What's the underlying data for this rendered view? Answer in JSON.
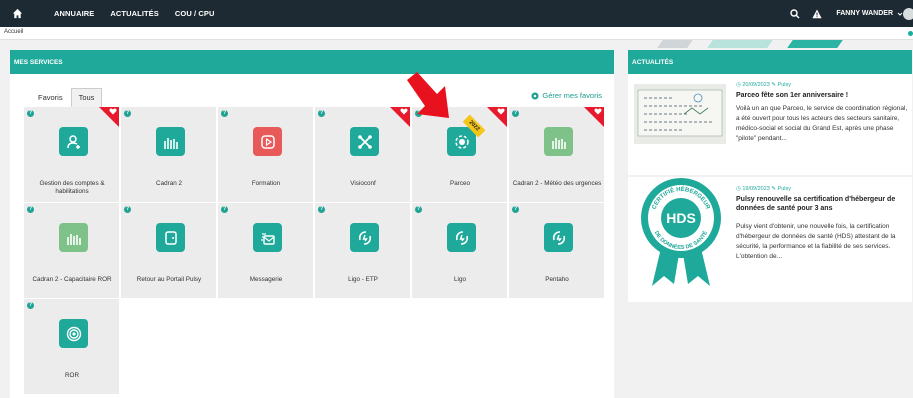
{
  "nav": {
    "items": [
      "ANNUAIRE",
      "ACTUALITÉS",
      "COU / CPU"
    ],
    "user": "FANNY WANDER"
  },
  "breadcrumb": "Accueil",
  "services": {
    "title": "MES SERVICES",
    "tabs": [
      "Favoris",
      "Tous"
    ],
    "manage_label": "Gérer mes favoris",
    "tiles": [
      {
        "label": "Gestion des comptes & habilitations",
        "icon": "user-plus-icon",
        "color": "#1fa99a",
        "fav": true
      },
      {
        "label": "Cadran 2",
        "icon": "bars-icon",
        "color": "#1fa99a",
        "fav": false
      },
      {
        "label": "Formation",
        "icon": "play-icon",
        "color": "#e85a5a",
        "fav": false
      },
      {
        "label": "Visioconf",
        "icon": "share-icon",
        "color": "#1fa99a",
        "fav": true
      },
      {
        "label": "Parceo",
        "icon": "parceo-icon",
        "color": "#1fa99a",
        "fav": true,
        "badge": "2022"
      },
      {
        "label": "Cadran 2 - Météo des urgences",
        "icon": "bars-icon",
        "color": "#7ec28a",
        "fav": true
      },
      {
        "label": "Cadran 2 - Capacitaire ROR",
        "icon": "bars-icon",
        "color": "#7ec28a",
        "fav": false
      },
      {
        "label": "Retour au Portail Pulsy",
        "icon": "portal-icon",
        "color": "#1fa99a",
        "fav": false
      },
      {
        "label": "Messagerie",
        "icon": "mail-icon",
        "color": "#1fa99a",
        "fav": false
      },
      {
        "label": "Ligo - ETP",
        "icon": "ligo-icon",
        "color": "#1fa99a",
        "fav": false
      },
      {
        "label": "Ligo",
        "icon": "ligo-icon",
        "color": "#1fa99a",
        "fav": false
      },
      {
        "label": "Pentaho",
        "icon": "ligo-icon",
        "color": "#1fa99a",
        "fav": false
      },
      {
        "label": "ROR",
        "icon": "target-icon",
        "color": "#1fa99a",
        "fav": false
      }
    ]
  },
  "news": {
    "title": "ACTUALITÉS",
    "items": [
      {
        "date": "20/09/2023",
        "tag": "Pulsy",
        "title": "Parceo fête son 1er anniversaire !",
        "body": "Voilà un an que Parceo, le service de coordination régional, a été ouvert pour tous les acteurs des secteurs sanitaire, médico-social et social du Grand Est, après une phase \"pilote\" pendant..."
      },
      {
        "date": "19/09/2023",
        "tag": "Pulsy",
        "title": "Pulsy renouvelle sa certification d'hébergeur de données de santé pour 3 ans",
        "body": "Pulsy vient d'obtenir, une nouvelle fois, la certification d'hébergeur de données de santé (HDS) attestant de la sécurité, la performance et la fiabilité de ses services. L'obtention de...",
        "image_text": "HDS",
        "seal_text_top": "CERTIFIÉ HÉBERGEUR",
        "seal_text_bottom": "DE DONNÉES DE SANTÉ"
      }
    ]
  }
}
